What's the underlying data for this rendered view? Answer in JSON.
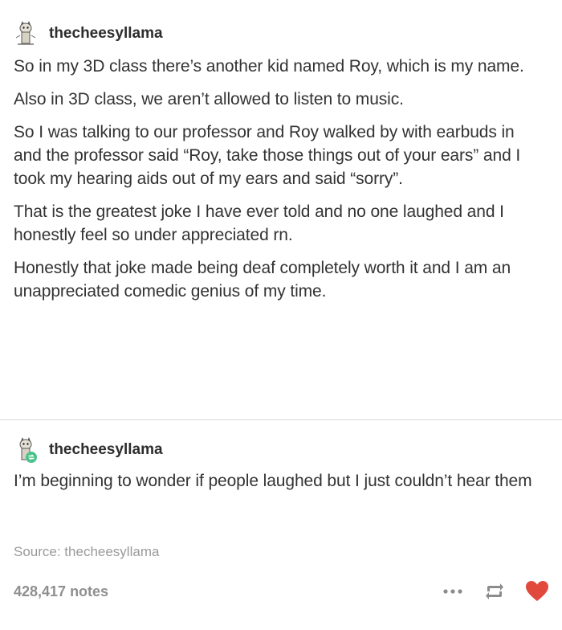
{
  "post": {
    "username": "thecheesyllama",
    "paragraphs": [
      "So in my 3D class there’s another kid named Roy, which is my name.",
      "Also in 3D class, we aren’t allowed to listen to music.",
      "So I was talking to our professor and Roy walked by with earbuds in and the professor said “Roy, take those things out of your ears” and I took my hearing aids out of my ears and said “sorry”.",
      "That is the greatest joke I have ever told and no one laughed and I honestly feel so under appreciated rn.",
      "Honestly that joke made being deaf completely worth it and I am an unappreciated comedic genius of my time."
    ]
  },
  "reblog": {
    "username": "thecheesyllama",
    "text": "I’m beginning to wonder if people laughed but I just couldn’t hear them"
  },
  "source": {
    "text": "Source: thecheesyllama"
  },
  "footer": {
    "notes": "428,417 notes",
    "icons": [
      "more-icon",
      "reblog-icon",
      "like-heart-icon"
    ],
    "heart_color": "#e2493d"
  }
}
